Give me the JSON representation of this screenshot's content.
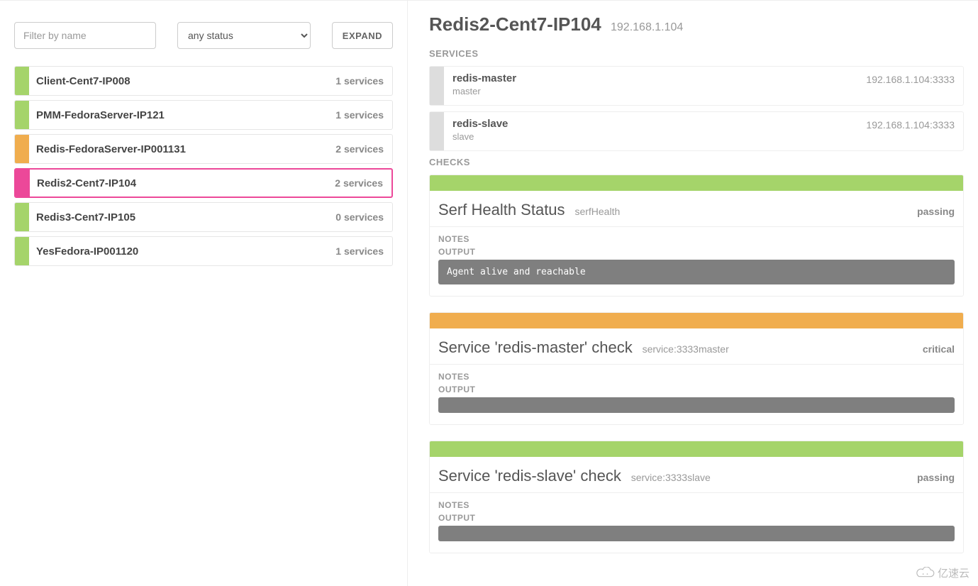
{
  "controls": {
    "filter_placeholder": "Filter by name",
    "status_option": "any status",
    "expand_label": "EXPAND"
  },
  "nodes": [
    {
      "name": "Client-Cent7-IP008",
      "count": "1 services",
      "status": "passing",
      "selected": false
    },
    {
      "name": "PMM-FedoraServer-IP121",
      "count": "1 services",
      "status": "passing",
      "selected": false
    },
    {
      "name": "Redis-FedoraServer-IP001131",
      "count": "2 services",
      "status": "warning",
      "selected": false
    },
    {
      "name": "Redis2-Cent7-IP104",
      "count": "2 services",
      "status": "selected",
      "selected": true
    },
    {
      "name": "Redis3-Cent7-IP105",
      "count": "0 services",
      "status": "passing",
      "selected": false
    },
    {
      "name": "YesFedora-IP001120",
      "count": "1 services",
      "status": "passing",
      "selected": false
    }
  ],
  "detail": {
    "title": "Redis2-Cent7-IP104",
    "ip": "192.168.1.104",
    "services_label": "SERVICES",
    "checks_label": "CHECKS",
    "services": [
      {
        "name": "redis-master",
        "sub": "master",
        "addr": "192.168.1.104:3333"
      },
      {
        "name": "redis-slave",
        "sub": "slave",
        "addr": "192.168.1.104:3333"
      }
    ],
    "checks": [
      {
        "title": "Serf Health Status",
        "id": "serfHealth",
        "status": "passing",
        "status_color": "passing",
        "notes_label": "NOTES",
        "output_label": "OUTPUT",
        "output": "Agent alive and reachable"
      },
      {
        "title": "Service 'redis-master' check",
        "id": "service:3333master",
        "status": "critical",
        "status_color": "warning",
        "notes_label": "NOTES",
        "output_label": "OUTPUT",
        "output": ""
      },
      {
        "title": "Service 'redis-slave' check",
        "id": "service:3333slave",
        "status": "passing",
        "status_color": "passing",
        "notes_label": "NOTES",
        "output_label": "OUTPUT",
        "output": ""
      }
    ]
  },
  "watermark": "亿速云"
}
